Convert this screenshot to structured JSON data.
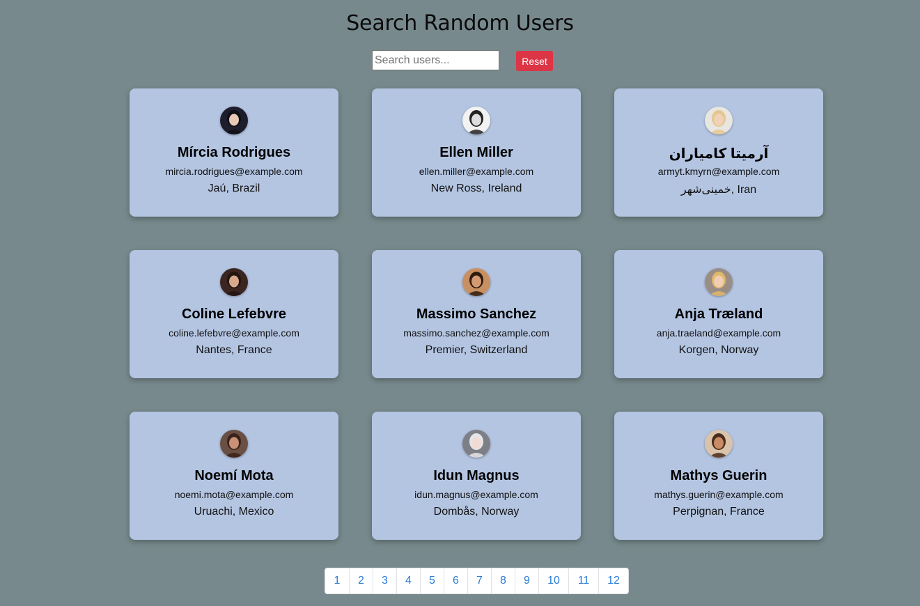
{
  "header": {
    "title": "Search Random Users"
  },
  "search": {
    "placeholder": "Search users...",
    "value": "",
    "reset_label": "Reset",
    "reset_color": "#dc3545"
  },
  "colors": {
    "background": "#77898c",
    "card": "#b4c5e2",
    "pagination_link": "#2a7ad5"
  },
  "users": [
    {
      "name": "Mírcia Rodrigues",
      "email": "mircia.rodrigues@example.com",
      "location": "Jaú, Brazil",
      "avatar": "avatar-photo"
    },
    {
      "name": "Ellen Miller",
      "email": "ellen.miller@example.com",
      "location": "New Ross, Ireland",
      "avatar": "avatar-photo"
    },
    {
      "name": "آرمیتا کامیاران",
      "email": "armyt.kmyrn@example.com",
      "location": "خمینی‌شهر, Iran",
      "avatar": "avatar-photo"
    },
    {
      "name": "Coline Lefebvre",
      "email": "coline.lefebvre@example.com",
      "location": "Nantes, France",
      "avatar": "avatar-photo"
    },
    {
      "name": "Massimo Sanchez",
      "email": "massimo.sanchez@example.com",
      "location": "Premier, Switzerland",
      "avatar": "avatar-photo"
    },
    {
      "name": "Anja Træland",
      "email": "anja.traeland@example.com",
      "location": "Korgen, Norway",
      "avatar": "avatar-photo"
    },
    {
      "name": "Noemí Mota",
      "email": "noemi.mota@example.com",
      "location": "Uruachi, Mexico",
      "avatar": "avatar-photo"
    },
    {
      "name": "Idun Magnus",
      "email": "idun.magnus@example.com",
      "location": "Dombås, Norway",
      "avatar": "avatar-photo"
    },
    {
      "name": "Mathys Guerin",
      "email": "mathys.guerin@example.com",
      "location": "Perpignan, France",
      "avatar": "avatar-photo"
    }
  ],
  "pagination": {
    "pages": [
      "1",
      "2",
      "3",
      "4",
      "5",
      "6",
      "7",
      "8",
      "9",
      "10",
      "11",
      "12"
    ]
  }
}
